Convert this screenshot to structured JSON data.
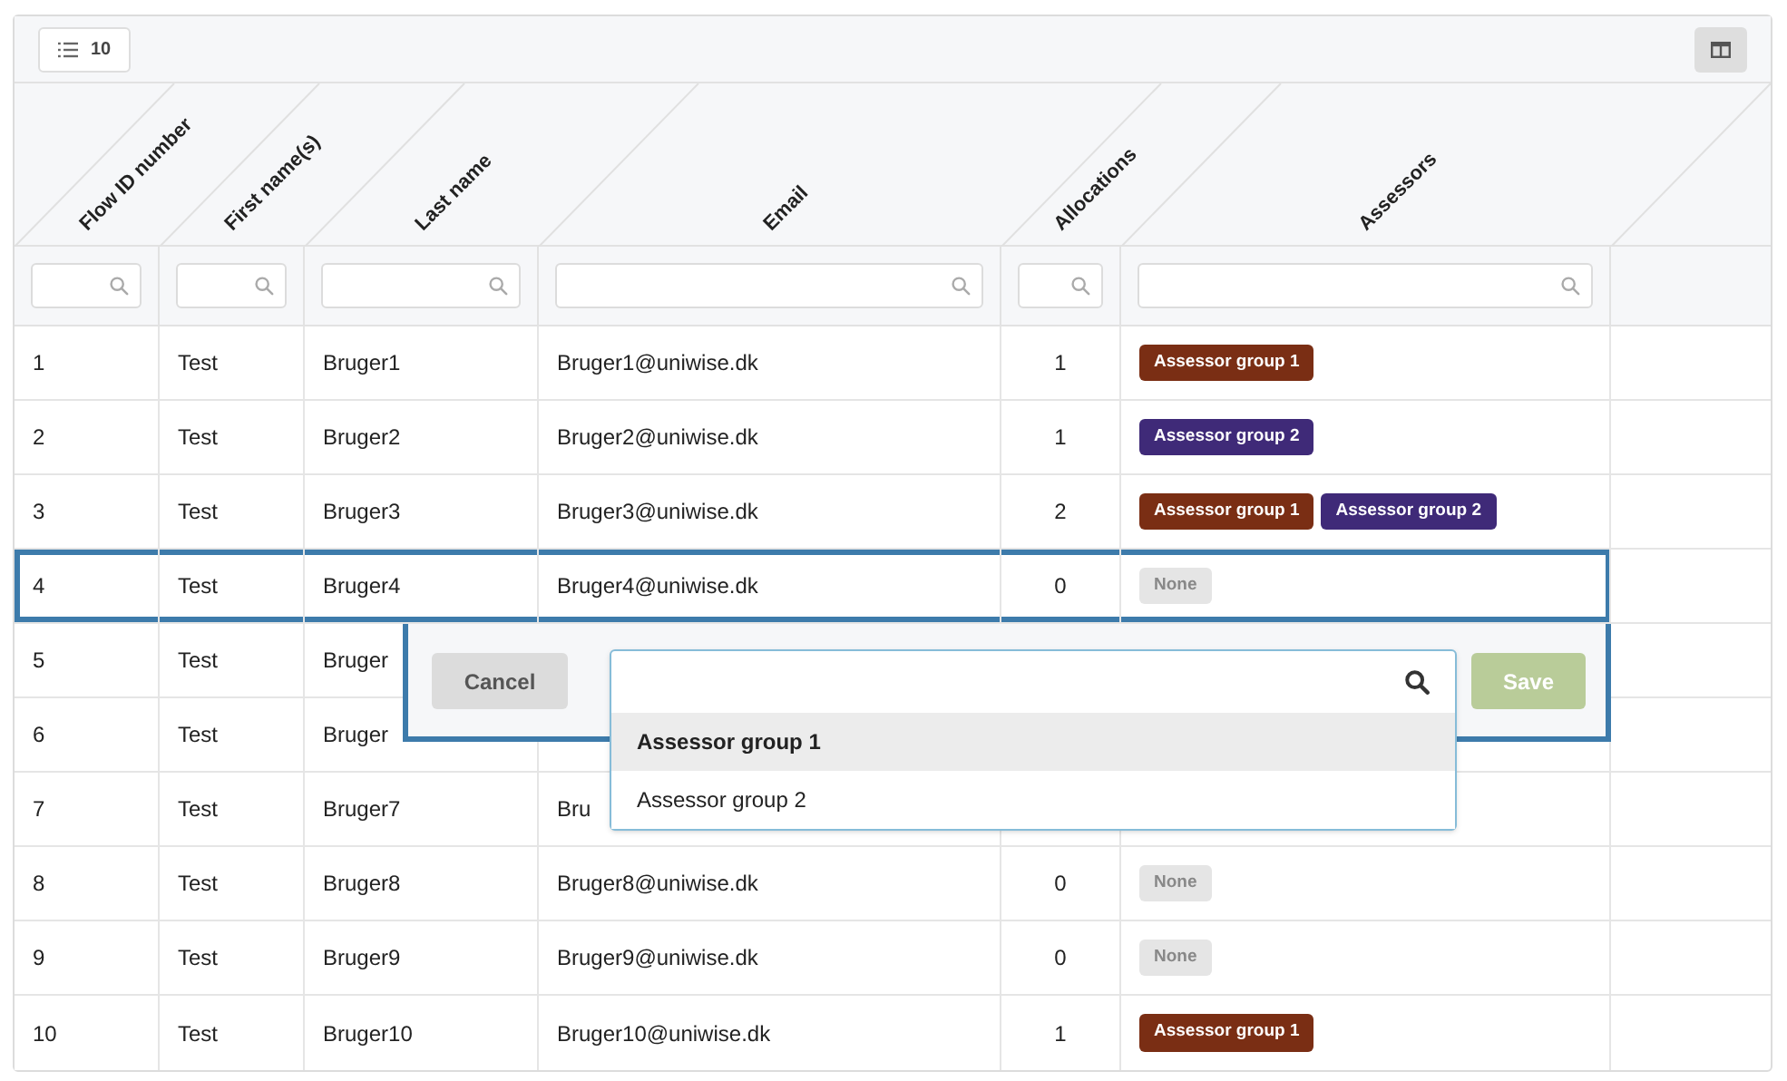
{
  "toolbar": {
    "page_size": "10",
    "columns_button": {
      "selected": true
    }
  },
  "columns": [
    {
      "label": "Flow ID number"
    },
    {
      "label": "First name(s)"
    },
    {
      "label": "Last name"
    },
    {
      "label": "Email"
    },
    {
      "label": "Allocations"
    },
    {
      "label": "Assessors"
    }
  ],
  "rows": [
    {
      "selected": false,
      "cells": [
        "1",
        "Test",
        "Bruger1",
        "Bruger1@uniwise.dk",
        "1"
      ],
      "assessors": [
        {
          "kind": "tag",
          "label": "Assessor group 1",
          "color": "#7a2e14"
        }
      ]
    },
    {
      "selected": false,
      "cells": [
        "2",
        "Test",
        "Bruger2",
        "Bruger2@uniwise.dk",
        "1"
      ],
      "assessors": [
        {
          "kind": "tag",
          "label": "Assessor group 2",
          "color": "#3f2a78"
        }
      ]
    },
    {
      "selected": false,
      "cells": [
        "3",
        "Test",
        "Bruger3",
        "Bruger3@uniwise.dk",
        "2"
      ],
      "assessors": [
        {
          "kind": "tag",
          "label": "Assessor group 1",
          "color": "#7a2e14"
        },
        {
          "kind": "tag",
          "label": "Assessor group 2",
          "color": "#3f2a78"
        }
      ]
    },
    {
      "selected": true,
      "cells": [
        "4",
        "Test",
        "Bruger4",
        "Bruger4@uniwise.dk",
        "0"
      ],
      "assessors": [
        {
          "kind": "none",
          "label": "None"
        }
      ]
    },
    {
      "selected": false,
      "cells": [
        "5",
        "Test",
        "Bruger"
      ]
    },
    {
      "selected": false,
      "cells": [
        "6",
        "Test",
        "Bruger"
      ]
    },
    {
      "selected": false,
      "cells": [
        "7",
        "Test",
        "Bruger7",
        "Bru"
      ]
    },
    {
      "selected": false,
      "cells": [
        "8",
        "Test",
        "Bruger8",
        "Bruger8@uniwise.dk",
        "0"
      ],
      "assessors": [
        {
          "kind": "none",
          "label": "None"
        }
      ]
    },
    {
      "selected": false,
      "cells": [
        "9",
        "Test",
        "Bruger9",
        "Bruger9@uniwise.dk",
        "0"
      ],
      "assessors": [
        {
          "kind": "none",
          "label": "None"
        }
      ]
    },
    {
      "selected": false,
      "cells": [
        "10",
        "Test",
        "Bruger10",
        "Bruger10@uniwise.dk",
        "1"
      ],
      "assessors": [
        {
          "kind": "tag",
          "label": "Assessor group 1",
          "color": "#7a2e14"
        }
      ]
    }
  ],
  "editor": {
    "cancel": "Cancel",
    "save": {
      "label": "Save",
      "disabled": true
    },
    "options": [
      {
        "label": "Assessor group 1",
        "selected": true
      },
      {
        "label": "Assessor group 2",
        "selected": false
      }
    ]
  }
}
